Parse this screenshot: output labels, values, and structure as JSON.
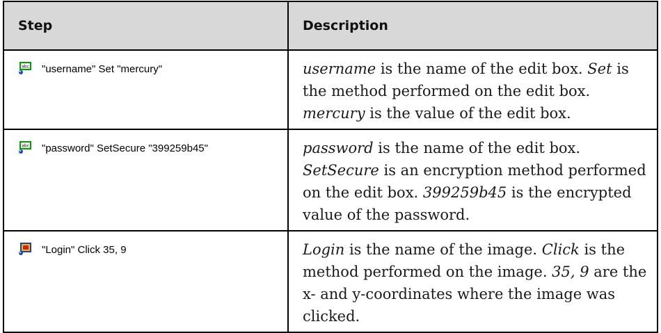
{
  "header": {
    "step": "Step",
    "description": "Description"
  },
  "rows": [
    {
      "icon": "edit-box-icon",
      "step": "\"username\" Set \"mercury\"",
      "desc": [
        {
          "t": "username",
          "i": true
        },
        {
          "t": " is the name of the edit box. ",
          "i": false
        },
        {
          "t": "Set",
          "i": true
        },
        {
          "t": " is the method performed on the edit box. ",
          "i": false
        },
        {
          "t": "mercury",
          "i": true
        },
        {
          "t": " is the value of the edit box.",
          "i": false
        }
      ]
    },
    {
      "icon": "edit-box-icon",
      "step": "\"password\" SetSecure \"399259b45\"",
      "desc": [
        {
          "t": "password",
          "i": true
        },
        {
          "t": " is the name of the edit box. ",
          "i": false
        },
        {
          "t": "SetSecure",
          "i": true
        },
        {
          "t": " is an encryption method performed on the edit box. ",
          "i": false
        },
        {
          "t": "399259b45",
          "i": true
        },
        {
          "t": " is the encrypted value of the password.",
          "i": false
        }
      ]
    },
    {
      "icon": "image-icon",
      "step": "\"Login\" Click 35, 9",
      "desc": [
        {
          "t": "Login",
          "i": true
        },
        {
          "t": " is the name of the image. ",
          "i": false
        },
        {
          "t": "Click",
          "i": true
        },
        {
          "t": " is the method performed on the image. ",
          "i": false
        },
        {
          "t": "35, 9",
          "i": true
        },
        {
          "t": " are the x- and y-coordinates where the image was clicked.",
          "i": false
        }
      ]
    }
  ]
}
